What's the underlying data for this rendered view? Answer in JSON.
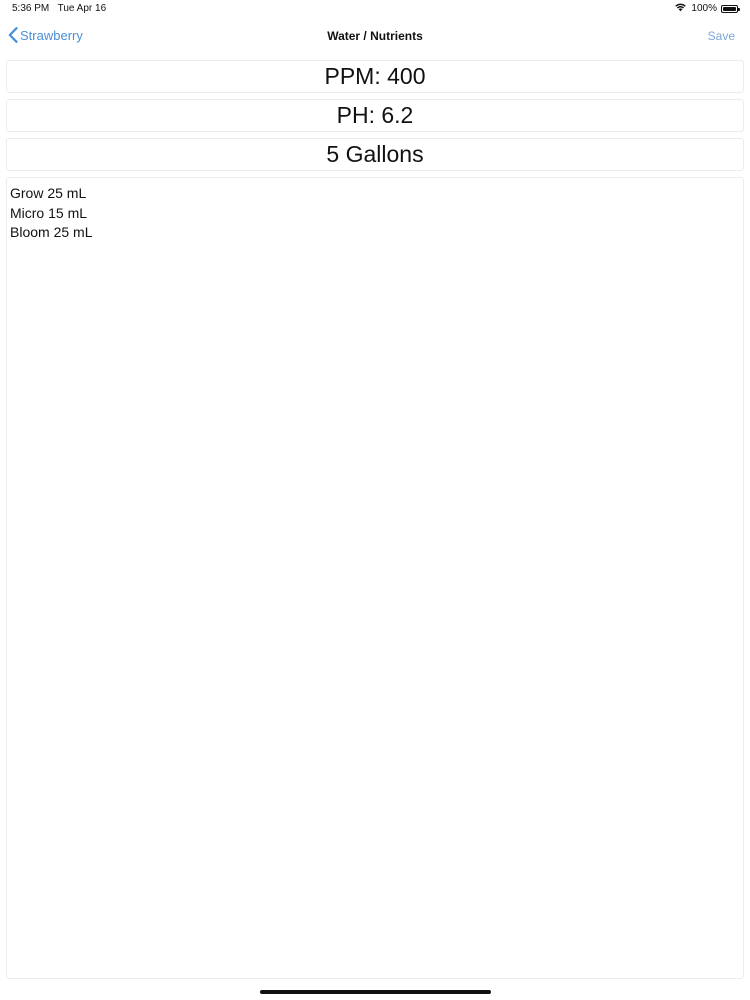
{
  "status_bar": {
    "time": "5:36 PM",
    "date": "Tue Apr 16",
    "battery_percent": "100%",
    "battery_level": 1.0
  },
  "nav": {
    "back_label": "Strawberry",
    "title": "Water / Nutrients",
    "save_label": "Save"
  },
  "fields": {
    "ppm": "PPM: 400",
    "ph": "PH: 6.2",
    "volume": "5 Gallons"
  },
  "notes": {
    "lines": [
      "Grow 25 mL",
      "Micro 15 mL",
      "Bloom 25 mL"
    ]
  },
  "colors": {
    "accent": "#4a8fd6",
    "save_disabled": "#7aa8d8",
    "border": "#ececec"
  }
}
